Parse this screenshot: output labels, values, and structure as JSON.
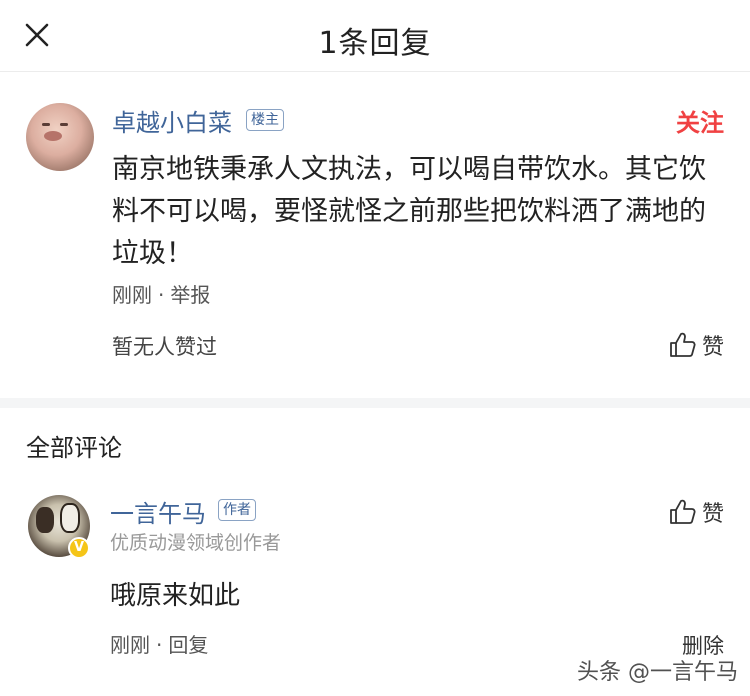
{
  "header": {
    "title": "1条回复",
    "close_icon": "close-icon"
  },
  "post": {
    "username": "卓越小白菜",
    "tag": "楼主",
    "follow_label": "关注",
    "text": "南京地铁秉承人文执法，可以喝自带饮水。其它饮料不可以喝，要怪就怪之前那些把饮料洒了满地的垃圾！",
    "time": "刚刚",
    "separator": "·",
    "report_label": "举报",
    "no_likes_text": "暂无人赞过",
    "like_label": "赞",
    "like_icon": "thumbs-up-icon"
  },
  "section": {
    "title": "全部评论"
  },
  "comment": {
    "username": "一言午马",
    "tag": "作者",
    "subtitle": "优质动漫领域创作者",
    "badge": "V",
    "text": "哦原来如此",
    "time": "刚刚",
    "separator": "·",
    "reply_label": "回复",
    "like_label": "赞",
    "delete_label": "删除"
  },
  "watermark": {
    "text": "头条 @一言午马"
  },
  "colors": {
    "link_blue": "#406599",
    "follow_red": "#f04142",
    "badge_yellow": "#f5c518"
  }
}
